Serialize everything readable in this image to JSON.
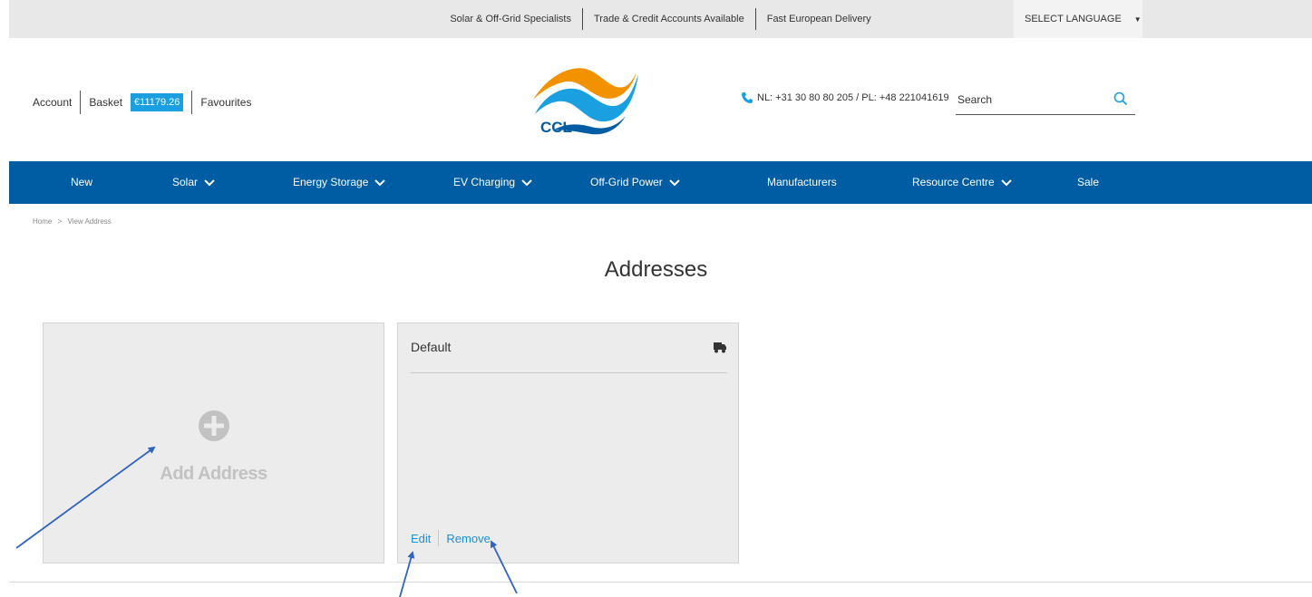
{
  "topbar": {
    "links": [
      "Solar & Off-Grid Specialists",
      "Trade & Credit Accounts Available",
      "Fast European Delivery"
    ],
    "language_label": "SELECT LANGUAGE"
  },
  "header": {
    "account_label": "Account",
    "basket_label": "Basket",
    "basket_total": "€11179.26",
    "favourites_label": "Favourites",
    "logo_text": "CCL",
    "phone_text": "NL: +31 30 80 80 205 / PL: +48 221041619",
    "search_placeholder": "Search"
  },
  "nav": {
    "items": [
      {
        "label": "New"
      },
      {
        "label": "Solar"
      },
      {
        "label": "Energy Storage"
      },
      {
        "label": "EV Charging"
      },
      {
        "label": "Off-Grid Power"
      },
      {
        "label": "Manufacturers"
      },
      {
        "label": "Resource Centre"
      },
      {
        "label": "Sale"
      }
    ]
  },
  "breadcrumb": {
    "home": "Home",
    "separator": ">",
    "current": "View Address"
  },
  "page": {
    "title": "Addresses"
  },
  "add_card": {
    "label": "Add Address",
    "icon": "plus-circle-icon"
  },
  "default_card": {
    "title": "Default",
    "icon": "truck-icon",
    "edit_label": "Edit",
    "remove_label": "Remove"
  },
  "colors": {
    "nav_bg": "#005ca3",
    "accent_blue": "#1aa0e0",
    "link_blue": "#1a90d6",
    "card_bg": "#ececec",
    "topbar_bg": "#e8e8e8",
    "annotation_arrow": "#2f63c0"
  }
}
